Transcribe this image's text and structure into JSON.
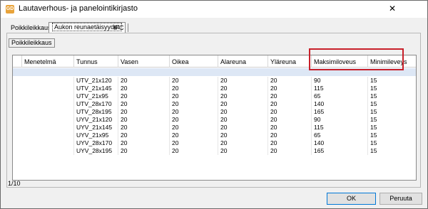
{
  "window": {
    "title": "Lautaverhous- ja panelointikirjasto",
    "app_icon_text": "GD",
    "close_glyph": "✕"
  },
  "tabs": [
    "Poikkileikkaus",
    "Aukon reunaetäisyydet",
    "IFC"
  ],
  "active_tab": 1,
  "subtab": {
    "label": "Poikkileikkaus"
  },
  "grid": {
    "columns": [
      "Menetelmä",
      "Tunnus",
      "Vasen",
      "Oikea",
      "Alareuna",
      "Yläreuna",
      "Maksimiloveus",
      "Minimileveys"
    ],
    "rows": [
      [
        "",
        "UTV_21x120",
        "20",
        "20",
        "20",
        "20",
        "90",
        "15"
      ],
      [
        "",
        "UTV_21x145",
        "20",
        "20",
        "20",
        "20",
        "115",
        "15"
      ],
      [
        "",
        "UTV_21x95",
        "20",
        "20",
        "20",
        "20",
        "65",
        "15"
      ],
      [
        "",
        "UTV_28x170",
        "20",
        "20",
        "20",
        "20",
        "140",
        "15"
      ],
      [
        "",
        "UTV_28x195",
        "20",
        "20",
        "20",
        "20",
        "165",
        "15"
      ],
      [
        "",
        "UYV_21x120",
        "20",
        "20",
        "20",
        "20",
        "90",
        "15"
      ],
      [
        "",
        "UYV_21x145",
        "20",
        "20",
        "20",
        "20",
        "115",
        "15"
      ],
      [
        "",
        "UYV_21x95",
        "20",
        "20",
        "20",
        "20",
        "65",
        "15"
      ],
      [
        "",
        "UYV_28x170",
        "20",
        "20",
        "20",
        "20",
        "140",
        "15"
      ],
      [
        "",
        "UYV_28x195",
        "20",
        "20",
        "20",
        "20",
        "165",
        "15"
      ]
    ]
  },
  "status": {
    "text": "1/10"
  },
  "buttons": {
    "ok": "OK",
    "cancel": "Peruuta"
  },
  "colors": {
    "highlight": "#c8202a",
    "new_row": "#dde7f5",
    "accent": "#0078d7"
  }
}
